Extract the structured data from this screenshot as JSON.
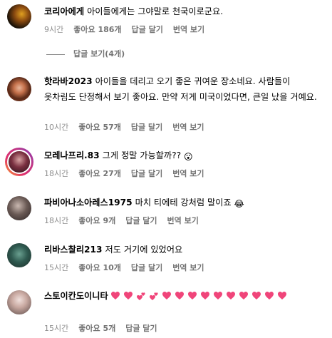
{
  "comments": [
    {
      "username": "코리아에게",
      "text": "아이들에게는 그야말로 천국이로군요.",
      "time": "9시간",
      "likes": "좋아요 186개",
      "reply": "답글 달기",
      "translate": "번역 보기",
      "view_replies": "답글 보기(4개)"
    },
    {
      "username": "핫라바2023",
      "text": "아이들을 데리고 오기 좋은 귀여운 장소네요. 사람들이 옷차림도 단정해서 보기 좋아요. 만약 저게 미국이었다면, 큰일 났을 거예요.",
      "time": "10시간",
      "likes": "좋아요 57개",
      "reply": "답글 달기",
      "translate": "번역 보기"
    },
    {
      "username": "모레나프리.83",
      "text": "그게 정말 가능할까??",
      "emoji": "😮",
      "time": "18시간",
      "likes": "좋아요 27개",
      "reply": "답글 달기",
      "translate": "번역 보기"
    },
    {
      "username": "파비아나소아레스1975",
      "text": "마치 티에테 강처럼 말이죠",
      "emoji": "😂",
      "time": "18시간",
      "likes": "좋아요 9개",
      "reply": "답글 달기",
      "translate": "번역 보기"
    },
    {
      "username": "리바스찰리213",
      "text": "저도 거기에 있었어요",
      "time": "15시간",
      "likes": "좋아요 10개",
      "reply": "답글 달기",
      "translate": "번역 보기"
    },
    {
      "username": "스토이칸도이니타",
      "text": "",
      "hearts": [
        "pink-heart",
        "pink-heart",
        "two-hearts",
        "two-hearts",
        "pink-heart",
        "pink-heart",
        "pink-heart",
        "pink-heart",
        "pink-heart",
        "pink-heart",
        "pink-heart",
        "pink-heart",
        "pink-heart",
        "pink-heart"
      ],
      "time": "15시간",
      "likes": "좋아요 5개",
      "reply": "답글 달기"
    }
  ],
  "colors": {
    "meta_text": "#8e8e8e",
    "heart": "#f0457a",
    "story_ring": "#e1306c"
  }
}
